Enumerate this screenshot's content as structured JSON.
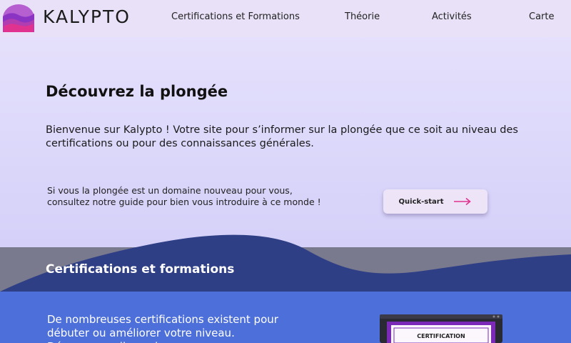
{
  "header": {
    "brand": "KALYPTO",
    "nav": [
      {
        "label": "Certifications et Formations"
      },
      {
        "label": "Théorie"
      },
      {
        "label": "Activités"
      },
      {
        "label": "Carte"
      }
    ]
  },
  "hero": {
    "title": "Découvrez la plongée",
    "text": "Bienvenue sur Kalypto ! Votre site pour s’informer sur la plongée que ce soit au niveau des certifications ou pour des connaissances générales.",
    "hint": "Si vous la plongée est un domaine nouveau pour vous, consultez notre guide pour bien vous introduire à ce monde !",
    "quickstart_label": "Quick-start"
  },
  "certifications": {
    "title": "Certifications et formations",
    "text": "De nombreuses certifications existent pour débuter ou améliorer votre niveau. Découvrez celles qui",
    "image_label": "CERTIFICATION"
  },
  "colors": {
    "accent": "#e0338f",
    "band": "#7a7a8e",
    "wave": "#2f3f86",
    "lower": "#4d6fd9"
  },
  "icons": {
    "logo": "wave-logo-icon",
    "quickstart": "arrow-right-icon"
  }
}
